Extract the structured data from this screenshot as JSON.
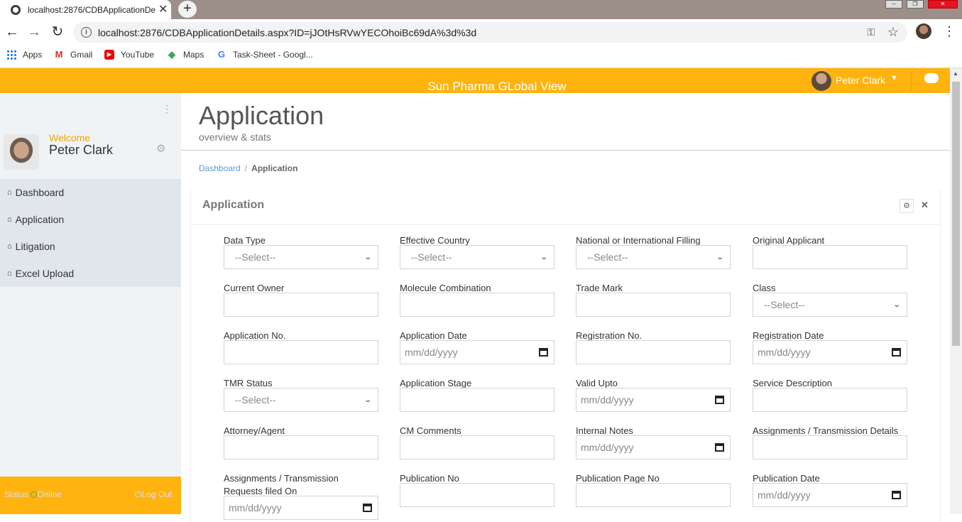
{
  "browser": {
    "tab_title": "localhost:2876/CDBApplicationDe",
    "tab_close": "✕",
    "new_tab": "+",
    "url": "localhost:2876/CDBApplicationDetails.aspx?ID=jJOtHsRVwYECOhoiBc69dA%3d%3d",
    "bookmarks": [
      "Apps",
      "Gmail",
      "YouTube",
      "Maps",
      "Task-Sheet - Googl..."
    ]
  },
  "header": {
    "title": "Sun Pharma GLobal View",
    "user_name": "Peter Clark"
  },
  "sidebar": {
    "welcome": "Welcome",
    "user_name": "Peter Clark",
    "items": [
      {
        "label": "Dashboard"
      },
      {
        "label": "Application"
      },
      {
        "label": "Litigation"
      },
      {
        "label": "Excel Upload"
      }
    ],
    "status_label": "Status",
    "status_value": "Online",
    "logout": "Log Out"
  },
  "page": {
    "title": "Application",
    "subtitle": "overview & stats",
    "breadcrumb": {
      "home": "Dashboard",
      "separator": "/",
      "current": "Application"
    }
  },
  "form": {
    "title": "Application",
    "fields": [
      {
        "label": "Data Type",
        "type": "select",
        "value": "--Select--"
      },
      {
        "label": "Effective Country",
        "type": "select",
        "value": "--Select--"
      },
      {
        "label": "National or International Filling",
        "type": "select",
        "value": "--Select--"
      },
      {
        "label": "Original Applicant",
        "type": "text",
        "value": ""
      },
      {
        "label": "Current Owner",
        "type": "text",
        "value": ""
      },
      {
        "label": "Molecule Combination",
        "type": "text",
        "value": ""
      },
      {
        "label": "Trade Mark",
        "type": "text",
        "value": ""
      },
      {
        "label": "Class",
        "type": "select",
        "value": "--Select--"
      },
      {
        "label": "Application No.",
        "type": "text",
        "value": ""
      },
      {
        "label": "Application Date",
        "type": "date",
        "value": "mm/dd/yyyy"
      },
      {
        "label": "Registration No.",
        "type": "text",
        "value": ""
      },
      {
        "label": "Registration Date",
        "type": "date",
        "value": "mm/dd/yyyy"
      },
      {
        "label": "TMR Status",
        "type": "select",
        "value": "--Select--"
      },
      {
        "label": "Application Stage",
        "type": "text",
        "value": ""
      },
      {
        "label": "Valid Upto",
        "type": "date",
        "value": "mm/dd/yyyy"
      },
      {
        "label": "Service Description",
        "type": "text",
        "value": ""
      },
      {
        "label": "Attorney/Agent",
        "type": "text",
        "value": ""
      },
      {
        "label": "CM Comments",
        "type": "text",
        "value": ""
      },
      {
        "label": "Internal Notes",
        "type": "date",
        "value": "mm/dd/yyyy"
      },
      {
        "label": "Assignments / Transmission Details",
        "type": "text",
        "value": ""
      },
      {
        "label": "Assignments / Transmission Requests filed On",
        "type": "date",
        "value": "mm/dd/yyyy"
      },
      {
        "label": "Publication No",
        "type": "text",
        "value": ""
      },
      {
        "label": "Publication Page No",
        "type": "text",
        "value": ""
      },
      {
        "label": "Publication Date",
        "type": "date",
        "value": "mm/dd/yyyy"
      }
    ]
  }
}
